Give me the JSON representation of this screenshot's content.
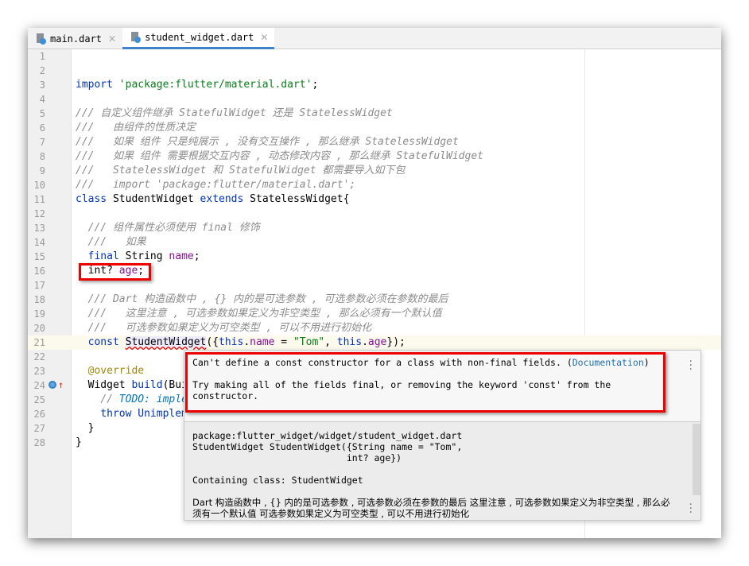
{
  "tabs": [
    {
      "label": "main.dart",
      "active": false
    },
    {
      "label": "student_widget.dart",
      "active": true
    }
  ],
  "code_lines": [
    [],
    [],
    [
      [
        "import",
        "kw"
      ],
      [
        " ",
        ""
      ],
      [
        "'package:flutter/material.dart'",
        "str"
      ],
      [
        ";",
        ""
      ]
    ],
    [],
    [
      [
        "/// 自定义组件继承 StatefulWidget 还是 StatelessWidget",
        "cm"
      ]
    ],
    [
      [
        "///   由组件的性质决定",
        "cm"
      ]
    ],
    [
      [
        "///   如果 组件 只是纯展示 , 没有交互操作 , 那么继承 StatelessWidget",
        "cm"
      ]
    ],
    [
      [
        "///   如果 组件 需要根据交互内容 , 动态修改内容 , 那么继承 StatefulWidget",
        "cm"
      ]
    ],
    [
      [
        "///   StatelessWidget 和 StatefulWidget 都需要导入如下包",
        "cm"
      ]
    ],
    [
      [
        "///   import 'package:flutter/material.dart';",
        "cm"
      ]
    ],
    [
      [
        "class",
        "kw"
      ],
      [
        " StudentWidget ",
        ""
      ],
      [
        "extends",
        "kw"
      ],
      [
        " StatelessWidget{",
        ""
      ]
    ],
    [],
    [
      [
        "  ",
        ""
      ],
      [
        "/// 组件属性必须使用 final 修饰",
        "cm"
      ]
    ],
    [
      [
        "  ",
        ""
      ],
      [
        "///   如果",
        "cm"
      ]
    ],
    [
      [
        "  ",
        ""
      ],
      [
        "final",
        "kw"
      ],
      [
        " String ",
        ""
      ],
      [
        "name",
        "fd"
      ],
      [
        ";",
        ""
      ]
    ],
    [
      [
        "  int? ",
        ""
      ],
      [
        "age",
        "fd"
      ],
      [
        ";",
        ""
      ]
    ],
    [],
    [
      [
        "  ",
        ""
      ],
      [
        "/// Dart 构造函数中 , {} 内的是可选参数 , 可选参数必须在参数的最后",
        "cm"
      ]
    ],
    [
      [
        "  ",
        ""
      ],
      [
        "///   这里注意 , 可选参数如果定义为非空类型 , 那么必须有一个默认值",
        "cm"
      ]
    ],
    [
      [
        "  ",
        ""
      ],
      [
        "///   可选参数如果定义为可空类型 , 可以不用进行初始化",
        "cm"
      ]
    ],
    [
      [
        "  ",
        ""
      ],
      [
        "const",
        "kw"
      ],
      [
        " ",
        ""
      ],
      [
        "StudentWidget",
        "err"
      ],
      [
        "({",
        ""
      ],
      [
        "this",
        "kw"
      ],
      [
        ".",
        ""
      ],
      [
        "name",
        "fd"
      ],
      [
        " = ",
        ""
      ],
      [
        "\"Tom\"",
        "str"
      ],
      [
        ", ",
        ""
      ],
      [
        "this",
        "kw"
      ],
      [
        ".",
        ""
      ],
      [
        "age",
        "fd"
      ],
      [
        "});",
        ""
      ]
    ],
    [],
    [
      [
        "  ",
        ""
      ],
      [
        "@override",
        "an"
      ]
    ],
    [
      [
        "  Widget ",
        ""
      ],
      [
        "build",
        "kw"
      ],
      [
        "(BuildContext context) {",
        ""
      ]
    ],
    [
      [
        "    ",
        ""
      ],
      [
        "// ",
        "cm"
      ],
      [
        "TODO: implement build",
        "td"
      ]
    ],
    [
      [
        "    ",
        ""
      ],
      [
        "throw",
        "kw"
      ],
      [
        " ",
        ""
      ],
      [
        "UnimplementedError",
        "kw"
      ],
      [
        "();",
        ""
      ]
    ],
    [
      [
        "  }",
        ""
      ]
    ],
    [
      [
        "}",
        ""
      ]
    ]
  ],
  "current_line": 21,
  "popup": {
    "error": "Can't define a const constructor for a class with non-final fields.",
    "doc_link": "Documentation",
    "fix": "Try making all of the fields final, or removing the keyword 'const' from the constructor.",
    "package": "package:flutter_widget/widget/student_widget.dart",
    "signature": "StudentWidget StudentWidget({String name = \"Tom\",\n                            int? age})",
    "containing_label": "Containing class:",
    "containing_class": "StudentWidget",
    "doc": "Dart 构造函数中 , {} 内的是可选参数 , 可选参数必须在参数的最后 这里注意 , 可选参数如果定义为非空类型 , 那么必须有一个默认值 可选参数如果定义为可空类型 , 可以不用进行初始化"
  },
  "colors": {
    "error_highlight": "#ff0000",
    "tab_accent": "#4083c9"
  }
}
